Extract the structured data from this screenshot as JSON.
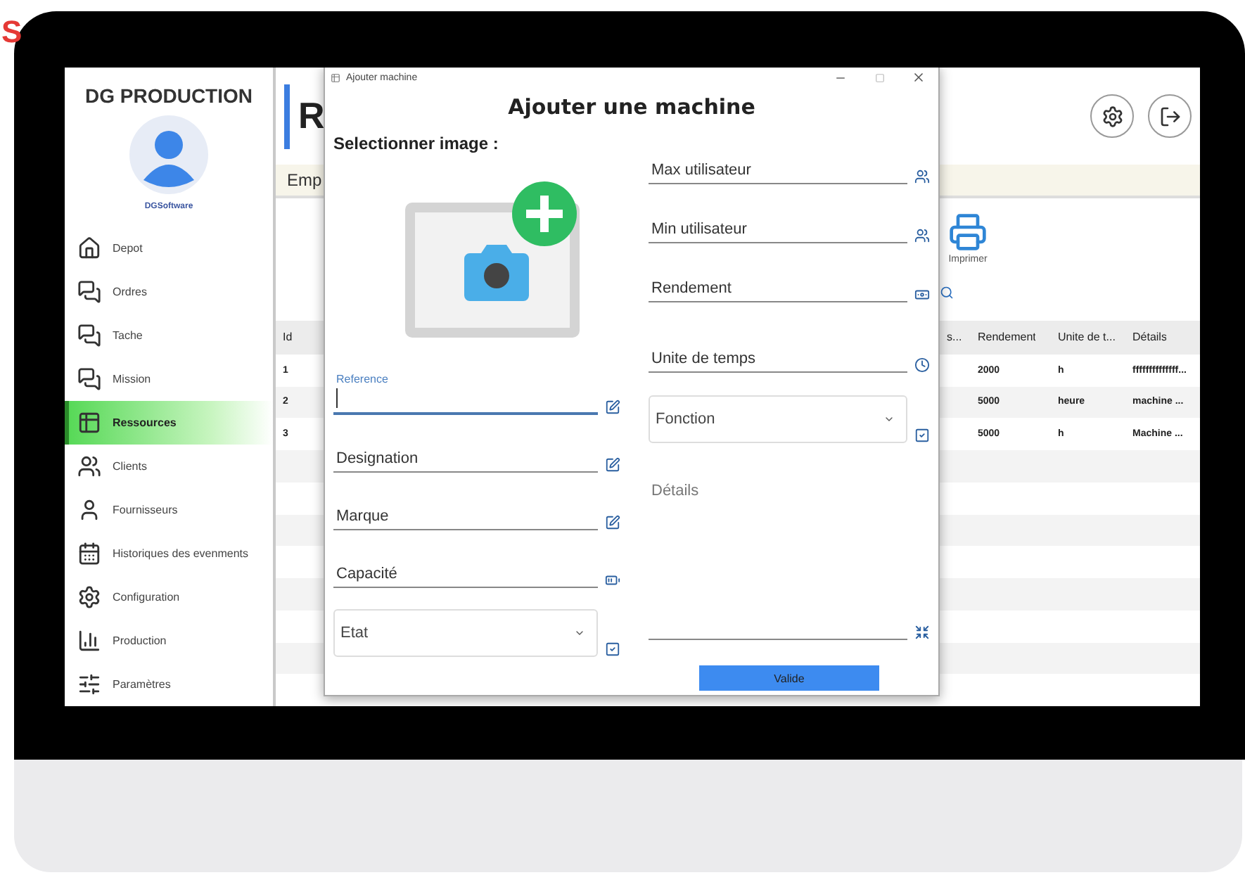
{
  "edge_text": "S",
  "sidebar": {
    "title": "DG PRODUCTION",
    "user": "DGSoftware",
    "items": [
      {
        "label": "Depot",
        "selected": false
      },
      {
        "label": "Ordres",
        "selected": false
      },
      {
        "label": "Tache",
        "selected": false
      },
      {
        "label": "Mission",
        "selected": false
      },
      {
        "label": "Ressources",
        "selected": true
      },
      {
        "label": "Clients",
        "selected": false
      },
      {
        "label": "Fournisseurs",
        "selected": false
      },
      {
        "label": "Historiques des evenments",
        "selected": false
      },
      {
        "label": "Configuration",
        "selected": false
      },
      {
        "label": "Production",
        "selected": false
      },
      {
        "label": "Paramètres",
        "selected": false
      }
    ]
  },
  "header": {
    "title": "R"
  },
  "tab_strip": {
    "label": "Emp"
  },
  "toolbar": {
    "print": "Imprimer"
  },
  "table": {
    "columns": [
      "Id",
      "s...",
      "Rendement",
      "Unite de t...",
      "Détails"
    ],
    "rows": [
      [
        "1",
        "",
        "2000",
        "h",
        "ffffffffffffff..."
      ],
      [
        "2",
        "",
        "5000",
        "heure",
        "machine ..."
      ],
      [
        "3",
        "",
        "5000",
        "h",
        "Machine ..."
      ]
    ]
  },
  "dialog": {
    "window_title": "Ajouter machine",
    "heading": "Ajouter une machine",
    "image_label": "Selectionner image :",
    "left_fields": [
      {
        "label": "Reference",
        "kind": "text",
        "focused": true
      },
      {
        "label": "Designation",
        "kind": "text",
        "focused": false
      },
      {
        "label": "Marque",
        "kind": "text",
        "focused": false
      },
      {
        "label": "Capacité",
        "kind": "text",
        "focused": false
      },
      {
        "label": "Etat",
        "kind": "combo"
      }
    ],
    "right_fields": [
      {
        "label": "Max utilisateur",
        "kind": "text",
        "focused": false
      },
      {
        "label": "Min utilisateur",
        "kind": "text",
        "focused": false
      },
      {
        "label": "Rendement",
        "kind": "text",
        "focused": false
      },
      {
        "label": "Unite de temps",
        "kind": "text",
        "focused": false
      },
      {
        "label": "Fonction",
        "kind": "combo"
      },
      {
        "label": "Détails",
        "kind": "textarea"
      }
    ],
    "submit": "Valide"
  }
}
